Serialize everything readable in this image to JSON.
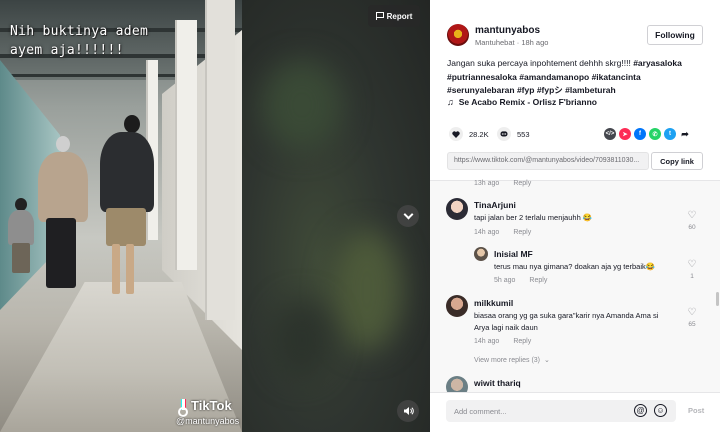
{
  "video": {
    "caption_overlay": "Nih buktinya adem ayem aja!!!!!!",
    "watermark_brand": "TikTok",
    "watermark_user": "@mantunyabos",
    "report_label": "Report"
  },
  "author": {
    "username": "mantunyabos",
    "display_name": "Mantuhebat",
    "posted_ago": "18h ago",
    "follow_label": "Following"
  },
  "description": {
    "text": "Jangan suka percaya inpohtement dehhh skrg!!!!",
    "hashtags": [
      "#aryasaloka",
      "#putriannesaloka",
      "#amandamanopo",
      "#ikatancinta",
      "#serunyalebaran",
      "#fyp",
      "#fypシ",
      "#lambeturah"
    ]
  },
  "music": {
    "icon": "music-note-icon",
    "title": "Se Acabo Remix - Orlisz F'brianno"
  },
  "stats": {
    "likes": "28.2K",
    "comments": "553"
  },
  "share_icons": [
    "embed-icon",
    "pinterest-icon",
    "facebook-icon",
    "whatsapp-icon",
    "twitter-icon",
    "share-arrow-icon"
  ],
  "link": {
    "url": "https://www.tiktok.com/@mantunyabos/video/7093811030...",
    "copy_label": "Copy link"
  },
  "comments_list": {
    "partial_top": {
      "time": "13h ago",
      "reply": "Reply"
    },
    "items": [
      {
        "name": "TinaArjuni",
        "text": "tapi jalan ber 2 terlalu menjauhh 😂",
        "time": "14h ago",
        "reply": "Reply",
        "likes": "60"
      },
      {
        "name": "Inisial MF",
        "text": "terus mau nya gimana? doakan aja yg terbaik😂",
        "time": "5h ago",
        "reply": "Reply",
        "likes": "1"
      },
      {
        "name": "milkkumil",
        "text": "biasaa orang yg ga suka gara\"karir nya Amanda Ama si Arya lagi naik daun",
        "time": "14h ago",
        "reply": "Reply",
        "likes": "65"
      },
      {
        "name": "wiwit thariq"
      }
    ],
    "view_more": "View more replies (3)"
  },
  "composer": {
    "placeholder": "Add comment...",
    "post_label": "Post"
  },
  "colors": {
    "accent": "#fe2c55",
    "text": "#161823",
    "muted": "#8a8b91"
  }
}
